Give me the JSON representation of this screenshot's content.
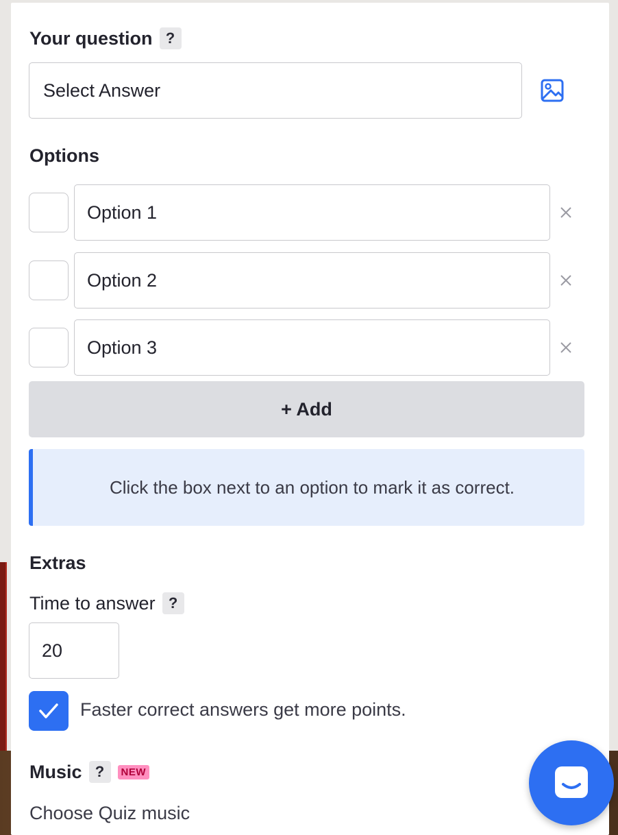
{
  "question": {
    "label": "Your question",
    "help": "?",
    "value": "Select Answer"
  },
  "options": {
    "label": "Options",
    "items": [
      {
        "value": "Option 1"
      },
      {
        "value": "Option 2"
      },
      {
        "value": "Option 3"
      }
    ],
    "add_label": "+ Add"
  },
  "hint": "Click the box next to an option to mark it as correct.",
  "extras": {
    "label": "Extras",
    "time_label": "Time to answer",
    "time_help": "?",
    "time_value": "20",
    "faster_label": "Faster correct answers get more points.",
    "faster_checked": true
  },
  "music": {
    "label": "Music",
    "help": "?",
    "badge": "NEW",
    "choose_label": "Choose Quiz music"
  },
  "icons": {
    "image": "image-icon",
    "remove": "close-icon",
    "check": "checkmark-icon",
    "chat": "chat-icon"
  },
  "colors": {
    "accent": "#2d6ff2",
    "hint_bg": "#e6eefc",
    "add_bg": "#dcdde1",
    "new_badge": "#ff8fbf"
  }
}
